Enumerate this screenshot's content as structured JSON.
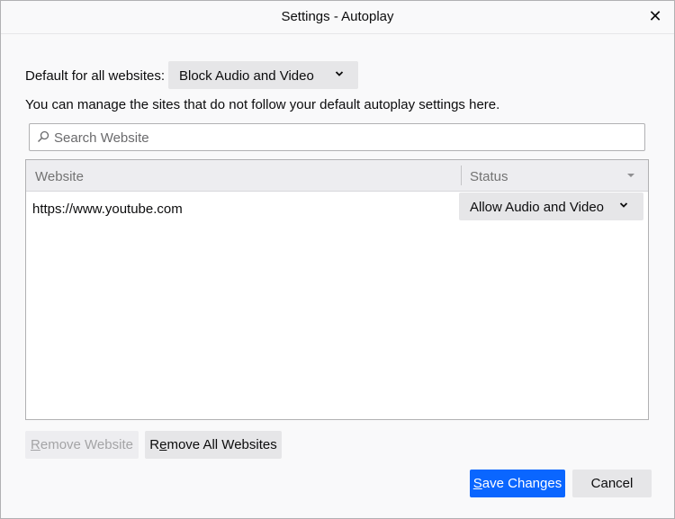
{
  "dialog": {
    "title": "Settings - Autoplay"
  },
  "default_setting": {
    "label": "Default for all websites:",
    "selected": "Block Audio and Video"
  },
  "help_text": "You can manage the sites that do not follow your default autoplay settings here.",
  "search": {
    "placeholder": "Search Website",
    "value": ""
  },
  "table": {
    "columns": [
      "Website",
      "Status"
    ],
    "rows": [
      {
        "website": "https://www.youtube.com",
        "status": "Allow Audio and Video"
      }
    ]
  },
  "buttons": {
    "remove_website_u": "R",
    "remove_website_rest": "emove Website",
    "remove_all_first": "R",
    "remove_all_u": "e",
    "remove_all_rest": "move All Websites",
    "save_u": "S",
    "save_rest": "ave Changes",
    "cancel": "Cancel"
  },
  "icons": {
    "close": "close-icon",
    "dropdown": "chevron-down-icon",
    "search": "search-icon",
    "sort": "sort-arrow-icon"
  },
  "colors": {
    "primary": "#0a66ff",
    "button": "#e6e6e8",
    "background": "#f9f9fa"
  }
}
